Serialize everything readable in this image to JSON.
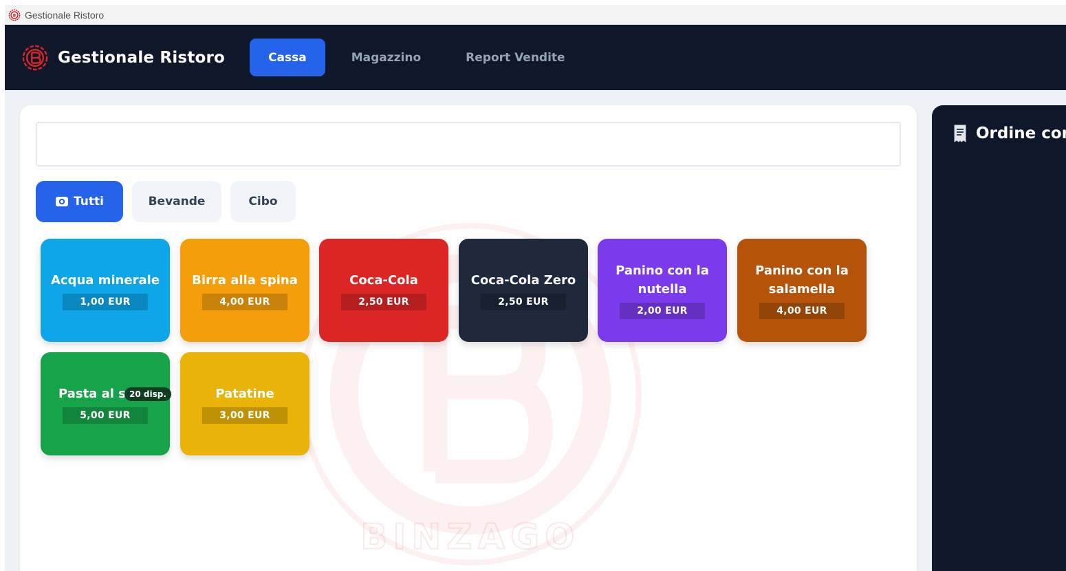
{
  "window": {
    "title": "Gestionale Ristoro",
    "icon": "bp-logo-icon"
  },
  "header": {
    "brand": "Gestionale Ristoro",
    "tabs": [
      {
        "label": "Cassa",
        "active": true
      },
      {
        "label": "Magazzino",
        "active": false
      },
      {
        "label": "Report Vendite",
        "active": false
      }
    ]
  },
  "search": {
    "value": "",
    "placeholder": ""
  },
  "categories": [
    {
      "label": "Tutti",
      "icon": "plate-icon",
      "active": true
    },
    {
      "label": "Bevande",
      "active": false
    },
    {
      "label": "Cibo",
      "active": false
    }
  ],
  "products": [
    {
      "name": "Acqua minerale",
      "price": "1,00 EUR",
      "color": "#0ea5e9"
    },
    {
      "name": "Birra alla spina",
      "price": "4,00 EUR",
      "color": "#f59e0b"
    },
    {
      "name": "Coca-Cola",
      "price": "2,50 EUR",
      "color": "#dc2626"
    },
    {
      "name": "Coca-Cola Zero",
      "price": "2,50 EUR",
      "color": "#1e293b"
    },
    {
      "name": "Panino con la nutella",
      "price": "2,00 EUR",
      "color": "#7c3aed"
    },
    {
      "name": "Panino con la salamella",
      "price": "4,00 EUR",
      "color": "#b45309"
    },
    {
      "name": "Pasta al sugo",
      "price": "5,00 EUR",
      "color": "#16a34a",
      "badge": "20 disp."
    },
    {
      "name": "Patatine",
      "price": "3,00 EUR",
      "color": "#eab308"
    }
  ],
  "order": {
    "title": "Ordine corr",
    "icon": "receipt-icon"
  },
  "watermark": {
    "text": "BINZAGO",
    "color": "#dc2626"
  }
}
